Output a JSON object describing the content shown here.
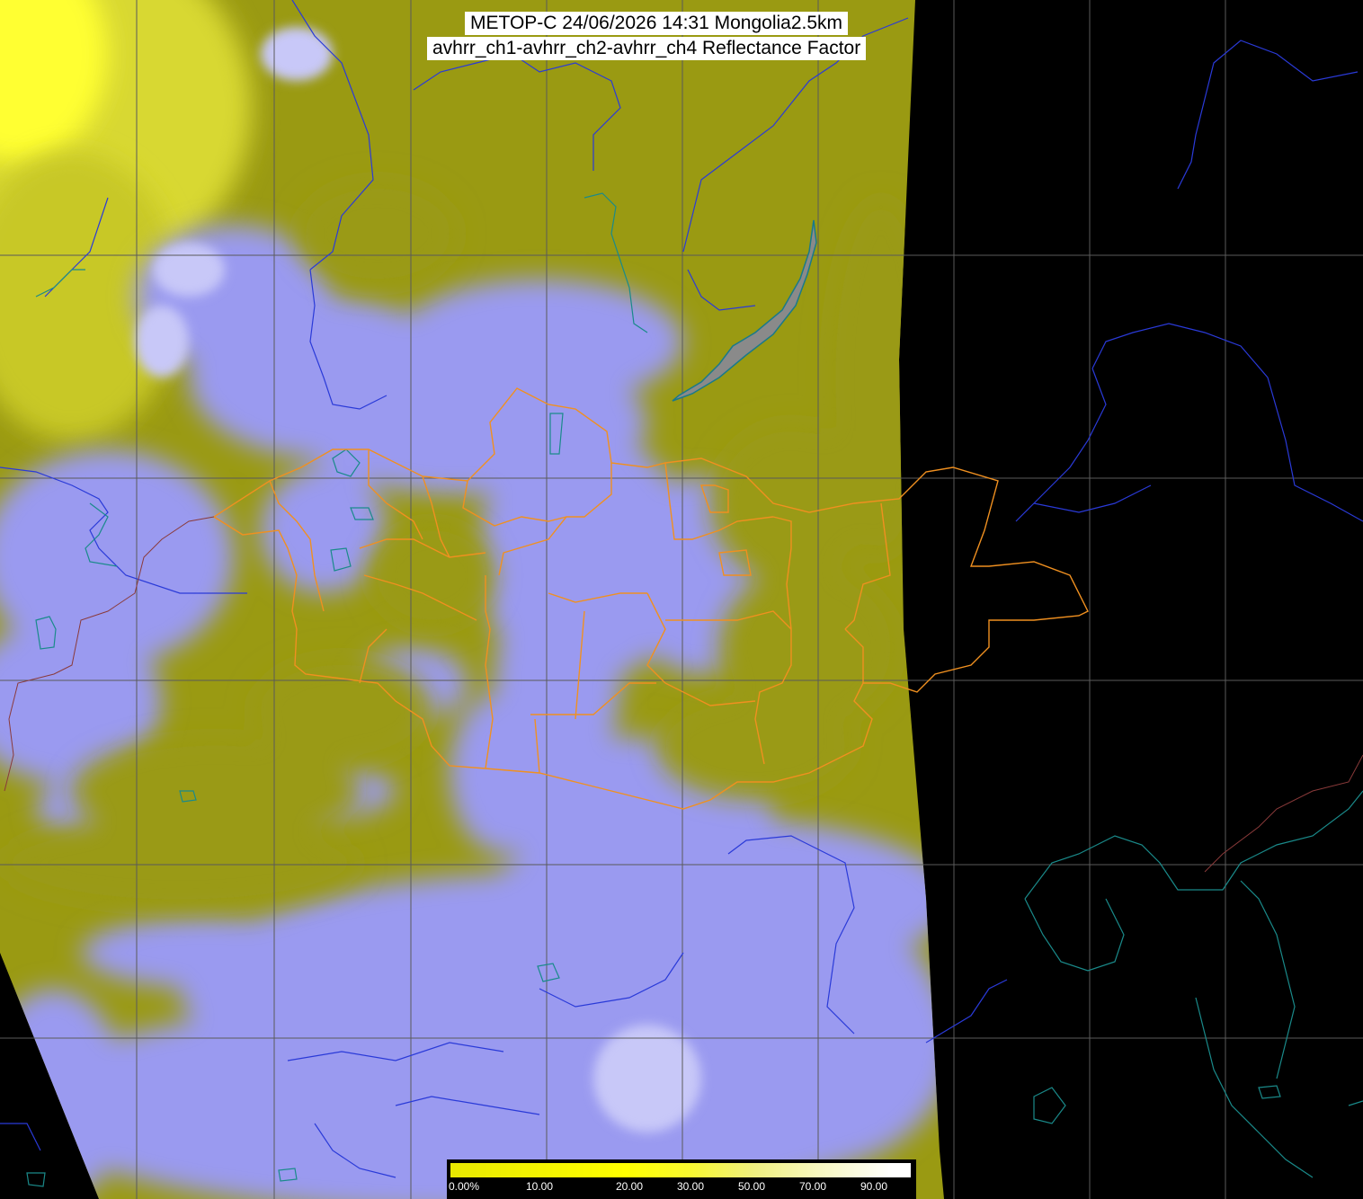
{
  "title": {
    "line1": "METOP-C 24/06/2026 14:31 Mongolia2.5km",
    "line2": "avhrr_ch1-avhrr_ch2-avhrr_ch4 Reflectance Factor"
  },
  "colorbar": {
    "labels": [
      "0.00%",
      "10.00",
      "20.00",
      "30.00",
      "50.00",
      "70.00",
      "90.00"
    ],
    "colors": [
      "#e8e800",
      "#ffff00",
      "#f8f830",
      "#f0f080",
      "#f8f8c0",
      "#ffffff"
    ]
  },
  "colors": {
    "background": "#000000",
    "land_surface": "#9b9b10",
    "cloud": "#9a9af2",
    "high_reflectance": "#ffff20",
    "grid": "#5a5a5a",
    "mongolia_borders": "#f09020",
    "rivers_coast": "#2a3ad8",
    "east_coast": "#1a7a8a"
  },
  "icons": [
    "lake-baikal-shape",
    "mongolia-border",
    "lat-lon-grid"
  ]
}
